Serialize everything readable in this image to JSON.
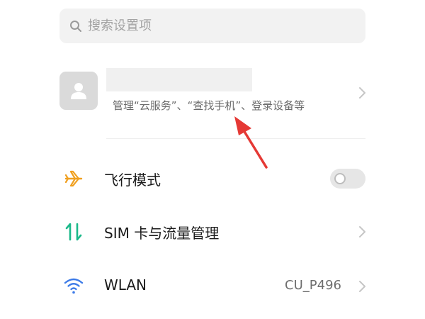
{
  "search": {
    "placeholder": "搜索设置项",
    "icon": "search-icon"
  },
  "account": {
    "name": "",
    "subtitle": "管理“云服务”、“查找手机”、登录设备等",
    "avatar_icon": "person-icon"
  },
  "settings": [
    {
      "label": "飞行模式",
      "icon": "airplane-icon",
      "control": "toggle",
      "toggle_on": false
    },
    {
      "label": "SIM 卡与流量管理",
      "icon": "sim-data-arrows-icon",
      "control": "chevron"
    },
    {
      "label": "WLAN",
      "icon": "wifi-icon",
      "value": "CU_P496",
      "control": "chevron"
    }
  ],
  "colors": {
    "airplane_icon": "#f0a020",
    "sim_icon": "#1bb98a",
    "wifi_icon": "#3d7be8",
    "annotation_arrow": "#e53935"
  }
}
